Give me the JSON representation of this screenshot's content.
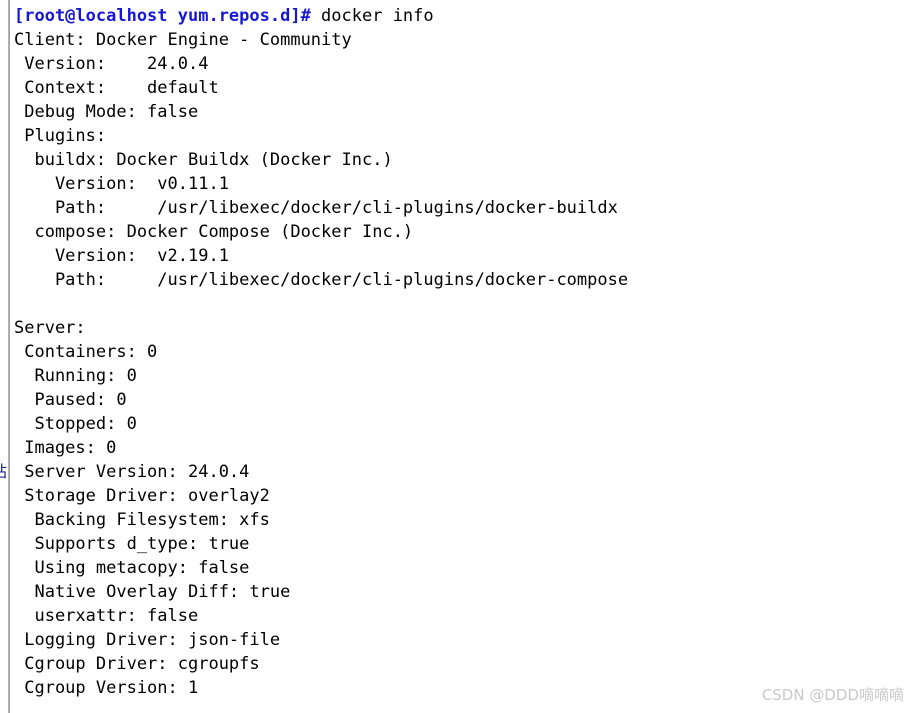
{
  "window": {
    "background_color": "#ffffff",
    "text_color": "#000000",
    "prompt_color": "#1818d4",
    "border_color": "#a8a8a8"
  },
  "terminal": {
    "prompt": {
      "text": "[root@localhost yum.repos.d]#",
      "command": " docker info"
    },
    "lines": [
      "Client: Docker Engine - Community",
      " Version:    24.0.4",
      " Context:    default",
      " Debug Mode: false",
      " Plugins:",
      "  buildx: Docker Buildx (Docker Inc.)",
      "    Version:  v0.11.1",
      "    Path:     /usr/libexec/docker/cli-plugins/docker-buildx",
      "  compose: Docker Compose (Docker Inc.)",
      "    Version:  v2.19.1",
      "    Path:     /usr/libexec/docker/cli-plugins/docker-compose",
      "",
      "Server:",
      " Containers: 0",
      "  Running: 0",
      "  Paused: 0",
      "  Stopped: 0",
      " Images: 0",
      " Server Version: 24.0.4",
      " Storage Driver: overlay2",
      "  Backing Filesystem: xfs",
      "  Supports d_type: true",
      "  Using metacopy: false",
      "  Native Overlay Diff: true",
      "  userxattr: false",
      " Logging Driver: json-file",
      " Cgroup Driver: cgroupfs",
      " Cgroup Version: 1"
    ]
  },
  "edge_artifact": {
    "glyph": "站"
  },
  "watermark": {
    "text": "CSDN @DDD嘀嘀嘀"
  }
}
